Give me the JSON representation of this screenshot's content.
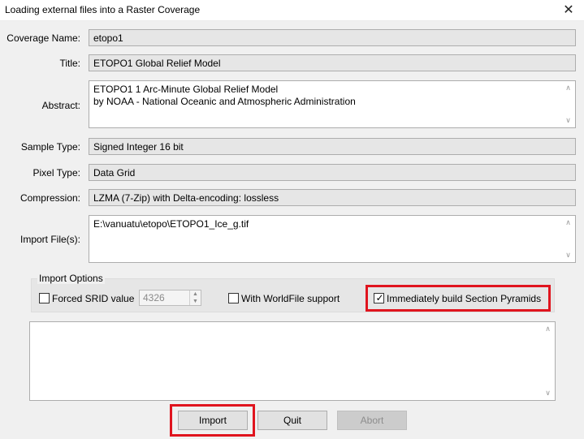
{
  "window": {
    "title": "Loading external files into a Raster Coverage",
    "close_glyph": "✕"
  },
  "fields": {
    "coverage_name": {
      "label": "Coverage Name:",
      "value": "etopo1"
    },
    "title": {
      "label": "Title:",
      "value": "ETOPO1 Global Relief Model"
    },
    "abstract": {
      "label": "Abstract:",
      "lines": [
        "ETOPO1 1 Arc-Minute Global Relief Model",
        "by NOAA - National Oceanic and Atmospheric Administration"
      ]
    },
    "sample_type": {
      "label": "Sample Type:",
      "value": "Signed Integer 16 bit"
    },
    "pixel_type": {
      "label": "Pixel Type:",
      "value": "Data Grid"
    },
    "compression": {
      "label": "Compression:",
      "value": "LZMA (7-Zip) with Delta-encoding: lossless"
    },
    "import_files": {
      "label": "Import File(s):",
      "lines": [
        "E:\\vanuatu\\etopo\\ETOPO1_Ice_g.tif"
      ]
    }
  },
  "import_options": {
    "group_label": "Import Options",
    "forced_srid": {
      "label": "Forced SRID value",
      "checked": false,
      "value": "4326"
    },
    "worldfile": {
      "label": "With WorldFile support",
      "checked": false
    },
    "pyramids": {
      "label": "Immediately build Section Pyramids",
      "checked": true
    }
  },
  "buttons": {
    "import": "Import",
    "quit": "Quit",
    "abort": "Abort"
  },
  "icons": {
    "check": "✓",
    "up": "▲",
    "down": "▼",
    "scroll_up": "∧",
    "scroll_down": "∨"
  },
  "colors": {
    "highlight": "#e0141e",
    "window_bg": "#f0f0f0",
    "readonly_field_bg": "#e6e6e6"
  }
}
